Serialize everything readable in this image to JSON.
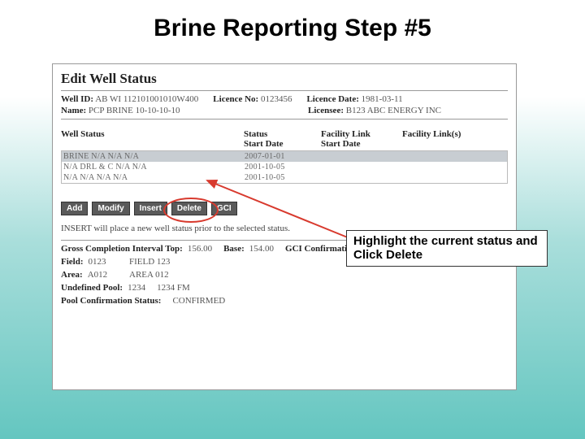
{
  "slide": {
    "title": "Brine Reporting Step #5"
  },
  "panel": {
    "heading": "Edit Well Status",
    "well_id_label": "Well ID:",
    "well_id_value": "AB WI 112101001010W400",
    "licence_no_label": "Licence No:",
    "licence_no_value": "0123456",
    "licence_date_label": "Licence Date:",
    "licence_date_value": "1981-03-11",
    "name_label": "Name:",
    "name_value": "PCP BRINE 10-10-10-10",
    "licensee_label": "Licensee:",
    "licensee_value": "B123 ABC ENERGY INC",
    "table": {
      "headers": {
        "well_status": "Well Status",
        "status_start": "Status\nStart Date",
        "facility_link_start": "Facility Link\nStart Date",
        "facility_links": "Facility Link(s)"
      },
      "rows": [
        {
          "ws": "BRINE  N/A  N/A  N/A",
          "sd": "2007-01-01",
          "fl": "",
          "fls": ""
        },
        {
          "ws": "N/A  DRL  &  C  N/A  N/A",
          "sd": "2001-10-05",
          "fl": "",
          "fls": ""
        },
        {
          "ws": "N/A  N/A  N/A  N/A",
          "sd": "2001-10-05",
          "fl": "",
          "fls": ""
        }
      ]
    },
    "buttons": {
      "add": "Add",
      "modify": "Modify",
      "insert": "Insert",
      "delete": "Delete",
      "gci": "GCI"
    },
    "insert_hint": "INSERT will place a new well status prior to the selected status.",
    "details": {
      "gci_top_label": "Gross Completion Interval Top:",
      "gci_top_value": "156.00",
      "base_label": "Base:",
      "base_value": "154.00",
      "gci_conf_label": "GCI Confirmation Status:",
      "field_label": "Field:",
      "field_code": "0123",
      "field_name": "FIELD 123",
      "area_label": "Area:",
      "area_code": "A012",
      "area_name": "AREA 012",
      "undef_pool_label": "Undefined Pool:",
      "undef_pool_code": "1234",
      "undef_pool_name": "1234 FM",
      "pool_conf_label": "Pool Confirmation Status:",
      "pool_conf_value": "CONFIRMED"
    }
  },
  "callout": {
    "text": "Highlight the current status and Click Delete"
  }
}
